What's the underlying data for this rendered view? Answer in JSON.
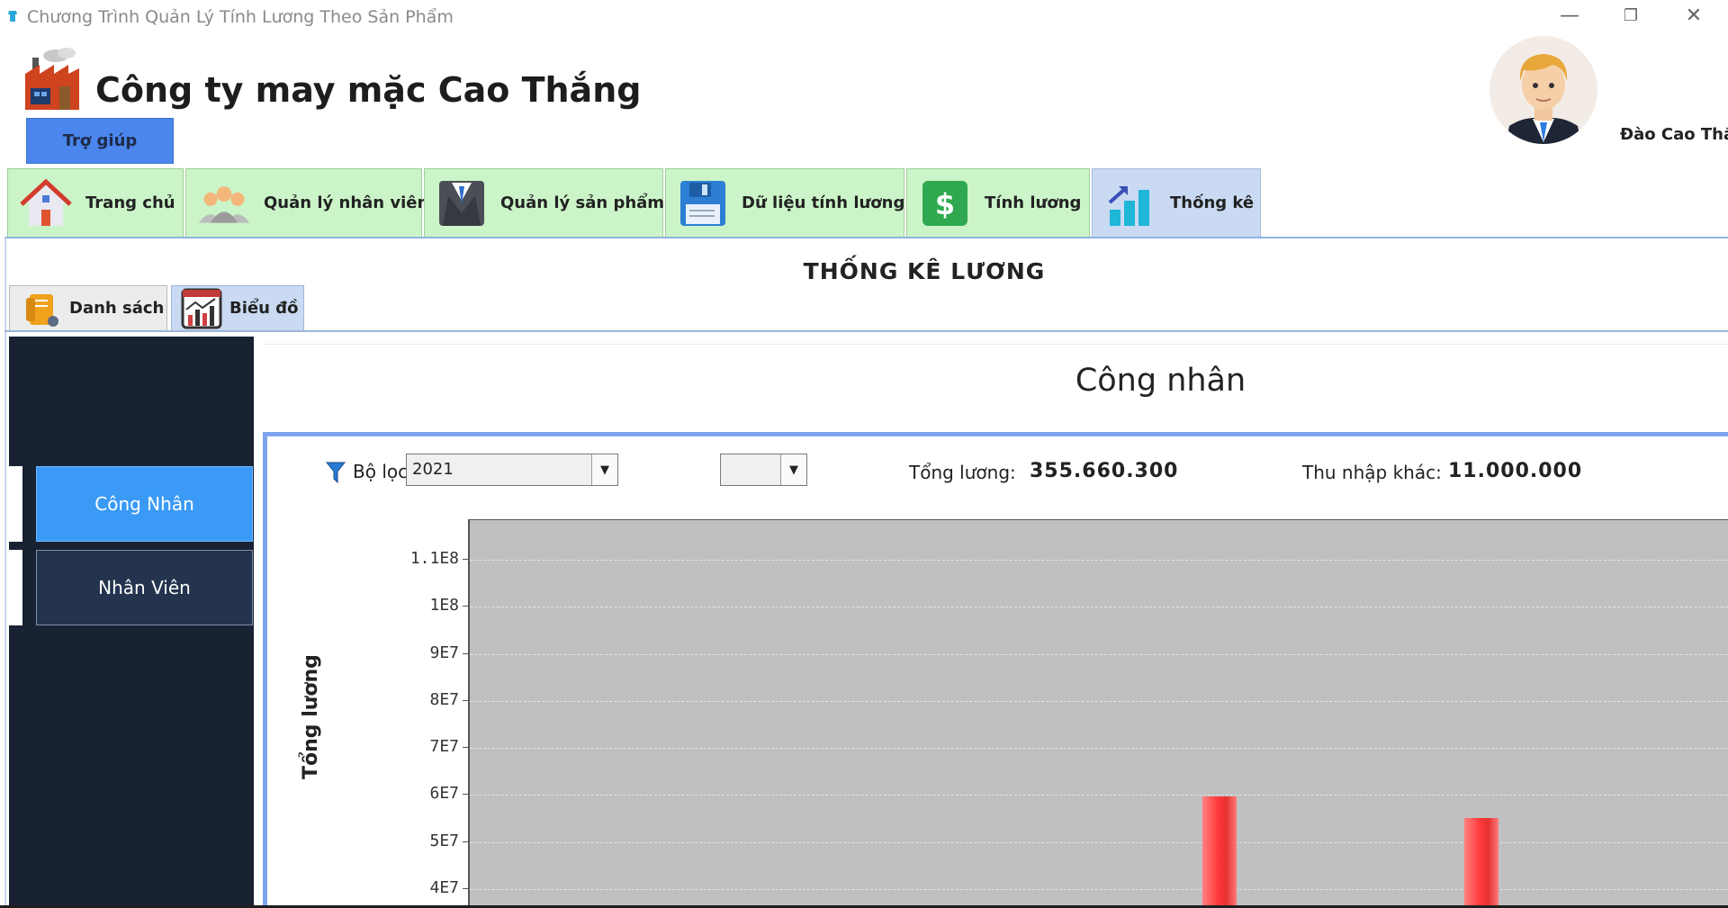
{
  "window": {
    "title": "Chương Trình Quản Lý Tính Lương Theo Sản Phẩm",
    "minimize": "—",
    "restore": "❐",
    "close": "✕"
  },
  "header": {
    "company_name": "Công ty may mặc Cao Thắng",
    "help_button": "Trợ giúp",
    "user_name": "Đào Cao Thắn"
  },
  "main_tabs": [
    {
      "label": "Trang chủ",
      "icon": "home-icon"
    },
    {
      "label": "Quản lý nhân viên",
      "icon": "people-icon"
    },
    {
      "label": "Quản lý sản phẩm",
      "icon": "suit-icon"
    },
    {
      "label": "Dữ liệu tính lương",
      "icon": "floppy-disk-icon"
    },
    {
      "label": "Tính lương",
      "icon": "dollar-icon"
    },
    {
      "label": "Thống kê",
      "icon": "bar-chart-icon",
      "active": true
    }
  ],
  "page": {
    "title": "THỐNG KÊ LƯƠNG",
    "sub_tabs": [
      {
        "label": "Danh sách",
        "icon": "document-list-icon"
      },
      {
        "label": "Biểu đồ",
        "icon": "chart-icon",
        "active": true
      }
    ]
  },
  "sidebar": {
    "items": [
      {
        "label": "Công Nhân",
        "active": true
      },
      {
        "label": "Nhân Viên",
        "active": false
      }
    ]
  },
  "panel": {
    "title": "Công nhân",
    "filter_label": "Bộ lọc",
    "year_value": "2021",
    "month_value": "",
    "total_salary_label": "Tổng lương:",
    "total_salary_value": "355.660.300",
    "other_income_label": "Thu nhập khác:",
    "other_income_value": "11.000.000"
  },
  "chart_data": {
    "type": "bar",
    "ylabel": "Tổng lương",
    "yticks": [
      "4E7",
      "5E7",
      "6E7",
      "7E7",
      "8E7",
      "9E7",
      "1E8",
      "1.1E8"
    ],
    "ytick_values": [
      40000000,
      50000000,
      60000000,
      70000000,
      80000000,
      90000000,
      100000000,
      110000000
    ],
    "visible_ylim": [
      36000000,
      111000000
    ],
    "bars": [
      {
        "value": 59500000
      },
      {
        "value": 55000000
      }
    ],
    "colors": {
      "bar": "#ff3b3b",
      "plot_bg": "#c0c0c0"
    }
  }
}
